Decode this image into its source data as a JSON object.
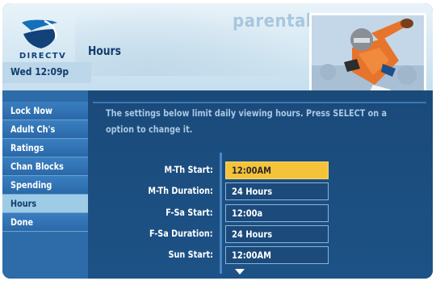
{
  "header": {
    "brand": "DIRECTV",
    "title": "Hours",
    "section": "parental",
    "datetime": "Wed 12:09p"
  },
  "nav": {
    "items": [
      {
        "label": "Lock Now"
      },
      {
        "label": "Adult Ch's"
      },
      {
        "label": "Ratings"
      },
      {
        "label": "Chan Blocks"
      },
      {
        "label": "Spending"
      },
      {
        "label": "Hours"
      },
      {
        "label": "Done"
      }
    ],
    "selected": "Hours"
  },
  "main": {
    "instructions_line1": "The settings below limit daily viewing hours. Press SELECT on a",
    "instructions_line2": "option to change it.",
    "settings": [
      {
        "label": "M-Th Start:",
        "value": "12:00AM"
      },
      {
        "label": "M-Th Duration:",
        "value": "24 Hours"
      },
      {
        "label": "F-Sa Start:",
        "value": "12:00a"
      },
      {
        "label": "F-Sa Duration:",
        "value": "24 Hours"
      },
      {
        "label": "Sun Start:",
        "value": "12:00AM"
      }
    ],
    "focused_setting": "M-Th Start:"
  },
  "colors": {
    "panel_bg": "#1a4a7a",
    "nav_bg": "#2d6ca8",
    "nav_selected": "#9ecbe6",
    "focus_yellow": "#f5c33a"
  },
  "icons": {
    "logo": "directv-logo-icon",
    "scroll": "scroll-down-icon"
  }
}
